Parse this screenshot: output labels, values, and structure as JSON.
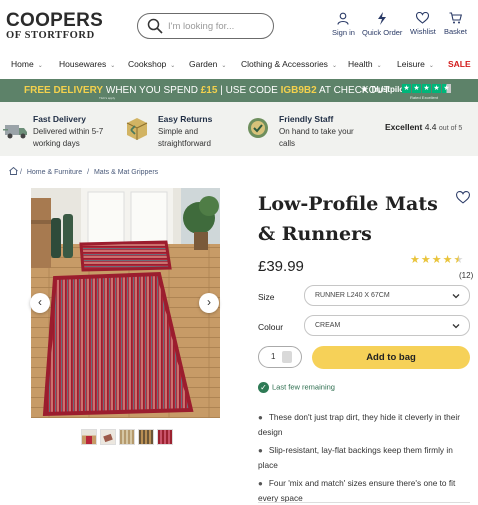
{
  "header": {
    "logo_line1": "COOPERS",
    "logo_line2": "OF STORTFORD",
    "search_placeholder": "I'm looking for...",
    "links": [
      "Sign in",
      "Quick Order",
      "Wishlist",
      "Basket"
    ]
  },
  "nav": {
    "items": [
      "Home",
      "Housewares",
      "Cookshop",
      "Garden",
      "Clothing & Accessories",
      "Health",
      "Leisure"
    ],
    "sale": "SALE"
  },
  "promo": {
    "free_delivery": "FREE DELIVERY",
    "when_spend": "WHEN YOU SPEND",
    "amount": "£15",
    "use_code": "USE CODE",
    "code": "IGB9B2",
    "at_checkout": "AT CHECKOUT",
    "tc": "T&C's apply",
    "trustpilot": "Trustpilot",
    "rated": "Rated Excellent"
  },
  "benefits": [
    {
      "title": "Fast Delivery",
      "line1": "Delivered within 5-7",
      "line2": "working days"
    },
    {
      "title": "Easy Returns",
      "line1": "Simple and",
      "line2": "straightforward"
    },
    {
      "title": "Friendly Staff",
      "line1": "On hand to take your",
      "line2": "calls"
    }
  ],
  "excellent": {
    "label": "Excellent",
    "score": "4.4",
    "suffix": "out of 5"
  },
  "breadcrumb": [
    "Home & Furniture",
    "Mats & Mat Grippers"
  ],
  "product": {
    "title": "Low-Profile Mats & Runners",
    "price": "£39.99",
    "rating_count": "(12)",
    "rating": 4.5,
    "size_label": "Size",
    "size_value": "RUNNER L240 X 67CM",
    "colour_label": "Colour",
    "colour_value": "CREAM",
    "quantity": "1",
    "add_to_bag": "Add to bag",
    "stock": "Last few remaining",
    "bullets": [
      "These don't just trap dirt, they hide it cleverly in their design",
      "Slip-resistant, lay-flat backings keep them firmly in place",
      "Four 'mix and match' sizes ensure there's one to fit every space"
    ]
  },
  "colors": {
    "accent": "#5d8269",
    "button": "#f6d158",
    "sale": "#d31b1b",
    "star": "#e9c43b"
  }
}
